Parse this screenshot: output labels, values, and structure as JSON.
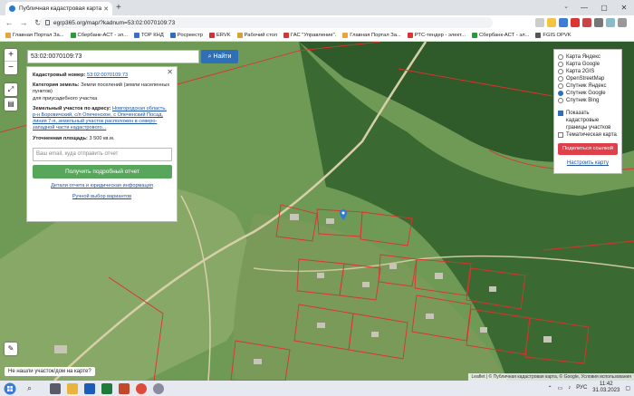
{
  "browser": {
    "tab_title": "Публичная кадастровая карта",
    "url": "egrp365.org/map/?kadnum=53:02:0070109:73",
    "bookmarks": [
      "Главная Портал За...",
      "Сбербанк-АСТ - эл...",
      "ТОР КНД",
      "Росреестр",
      "ERVK",
      "Рабочий стол",
      "ГАС \"Управление\".",
      "Главная Портал За...",
      "РТС-тендер - элект...",
      "Сбербанк-АСТ - эл...",
      "FGIS OPVK"
    ]
  },
  "search": {
    "value": "53:02:0070109:73",
    "button": "Найти"
  },
  "panel": {
    "cad_label": "Кадастровый номер:",
    "cad_value": "53:02:0070109:73",
    "cat_label": "Категория земель:",
    "cat_value": "Земли поселений (земли населенных пунктов)",
    "purpose": "для приусадебного участка",
    "addr_label": "Земельный участок по адресу:",
    "addr_value": "Новгородская область, р-н Боровичский, с/п Опеченское, с Опеченский Посад, линия 7-я, земельный участок расположен в северо-западной части кадастрового...",
    "area_label": "Уточненная площадь:",
    "area_value": "3 500 кв.м.",
    "email_placeholder": "Ваш email, куда отправить отчет",
    "get_report": "Получить подробный отчет",
    "details_link": "Детали отчета и юридическая информация",
    "manual_link": "Ручной выбор вариантов"
  },
  "layers": {
    "options": [
      "Карта Яндекс",
      "Карта Google",
      "Карта 2GIS",
      "OpenStreetMap",
      "Спутник Яндекс",
      "Спутник Google",
      "Спутник Bing"
    ],
    "selected": 5,
    "check_cadastre": "Показать кадастровые границы участков",
    "check_thematic": "Тематическая карта",
    "share": "Поделиться ссылкой",
    "setup": "Настроить карту"
  },
  "map": {
    "hint": "Не нашли участок/дом на карте?",
    "attribution": "Leaflet | © Публичная кадастровая карта, © Google, Условия использования"
  },
  "taskbar": {
    "lang": "РУС",
    "time": "11:42",
    "date": "31.03.2023"
  }
}
